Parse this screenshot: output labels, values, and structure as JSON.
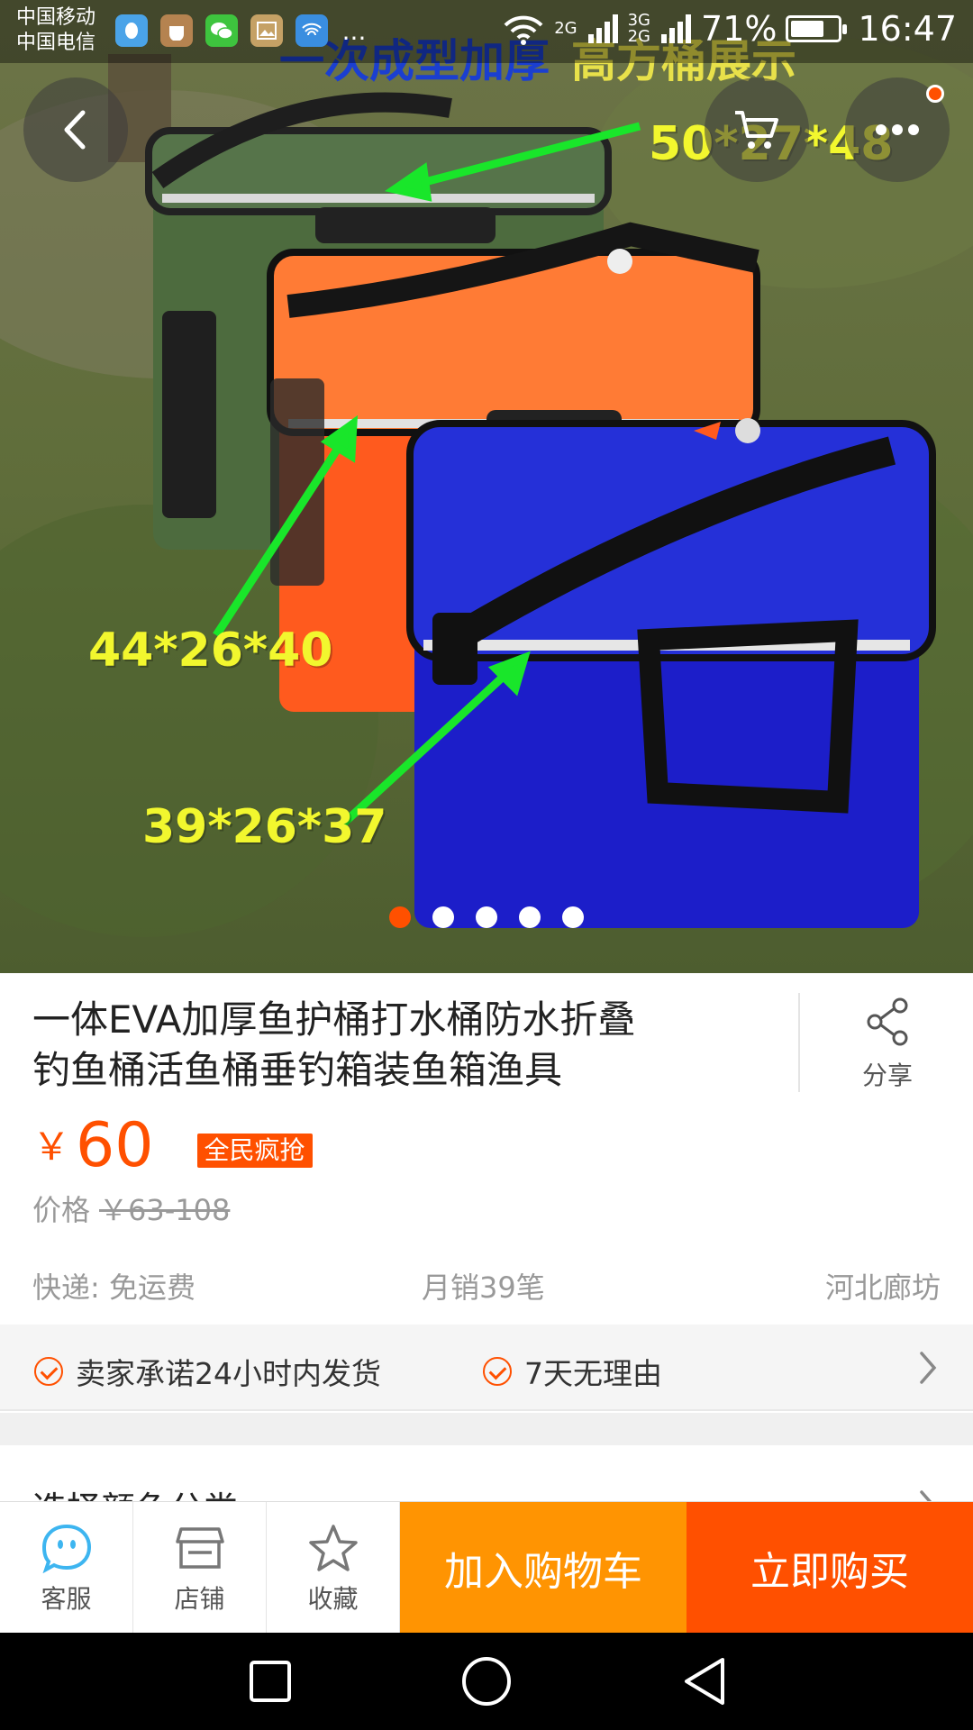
{
  "status_bar": {
    "carrier_1": "中国移动",
    "carrier_2": "中国电信",
    "net_1_top": "2G",
    "net_2_top": "3G",
    "net_2_bottom": "2G",
    "battery_percent": "71%",
    "battery_level": 0.71,
    "time": "16:47",
    "more_apps": "...",
    "app_icons": [
      "qq-icon",
      "pocket-app-icon",
      "wechat-icon",
      "gallery-icon",
      "wifi-app-icon"
    ]
  },
  "hero": {
    "banner_blue": "一次成型加厚",
    "banner_yellow": "高方桶展示",
    "dim_large": "50*27*48",
    "dim_medium": "44*26*40",
    "dim_small": "39*26*37",
    "carousel_total": 5,
    "carousel_active": 0
  },
  "product": {
    "title_line1": "一体EVA加厚鱼护桶打水桶防水折叠",
    "title_line2": "钓鱼桶活鱼桶垂钓箱装鱼箱渔具",
    "share_label": "分享",
    "currency": "￥",
    "price": "60",
    "promo_tag": "全民疯抢",
    "original_price_label": "价格",
    "original_price": "￥63-108",
    "shipping": "快递: 免运费",
    "monthly_sales": "月销39笔",
    "location": "河北廊坊",
    "promise_1": "卖家承诺24小时内发货",
    "promise_2": "7天无理由",
    "select_label": "选择颜色分类"
  },
  "action_bar": {
    "service_label": "客服",
    "shop_label": "店铺",
    "favorite_label": "收藏",
    "add_to_cart": "加入购物车",
    "buy_now": "立即购买"
  },
  "colors": {
    "accent": "#ff5000",
    "cart_button": "#ff9402",
    "service_icon": "#3db5f0"
  }
}
